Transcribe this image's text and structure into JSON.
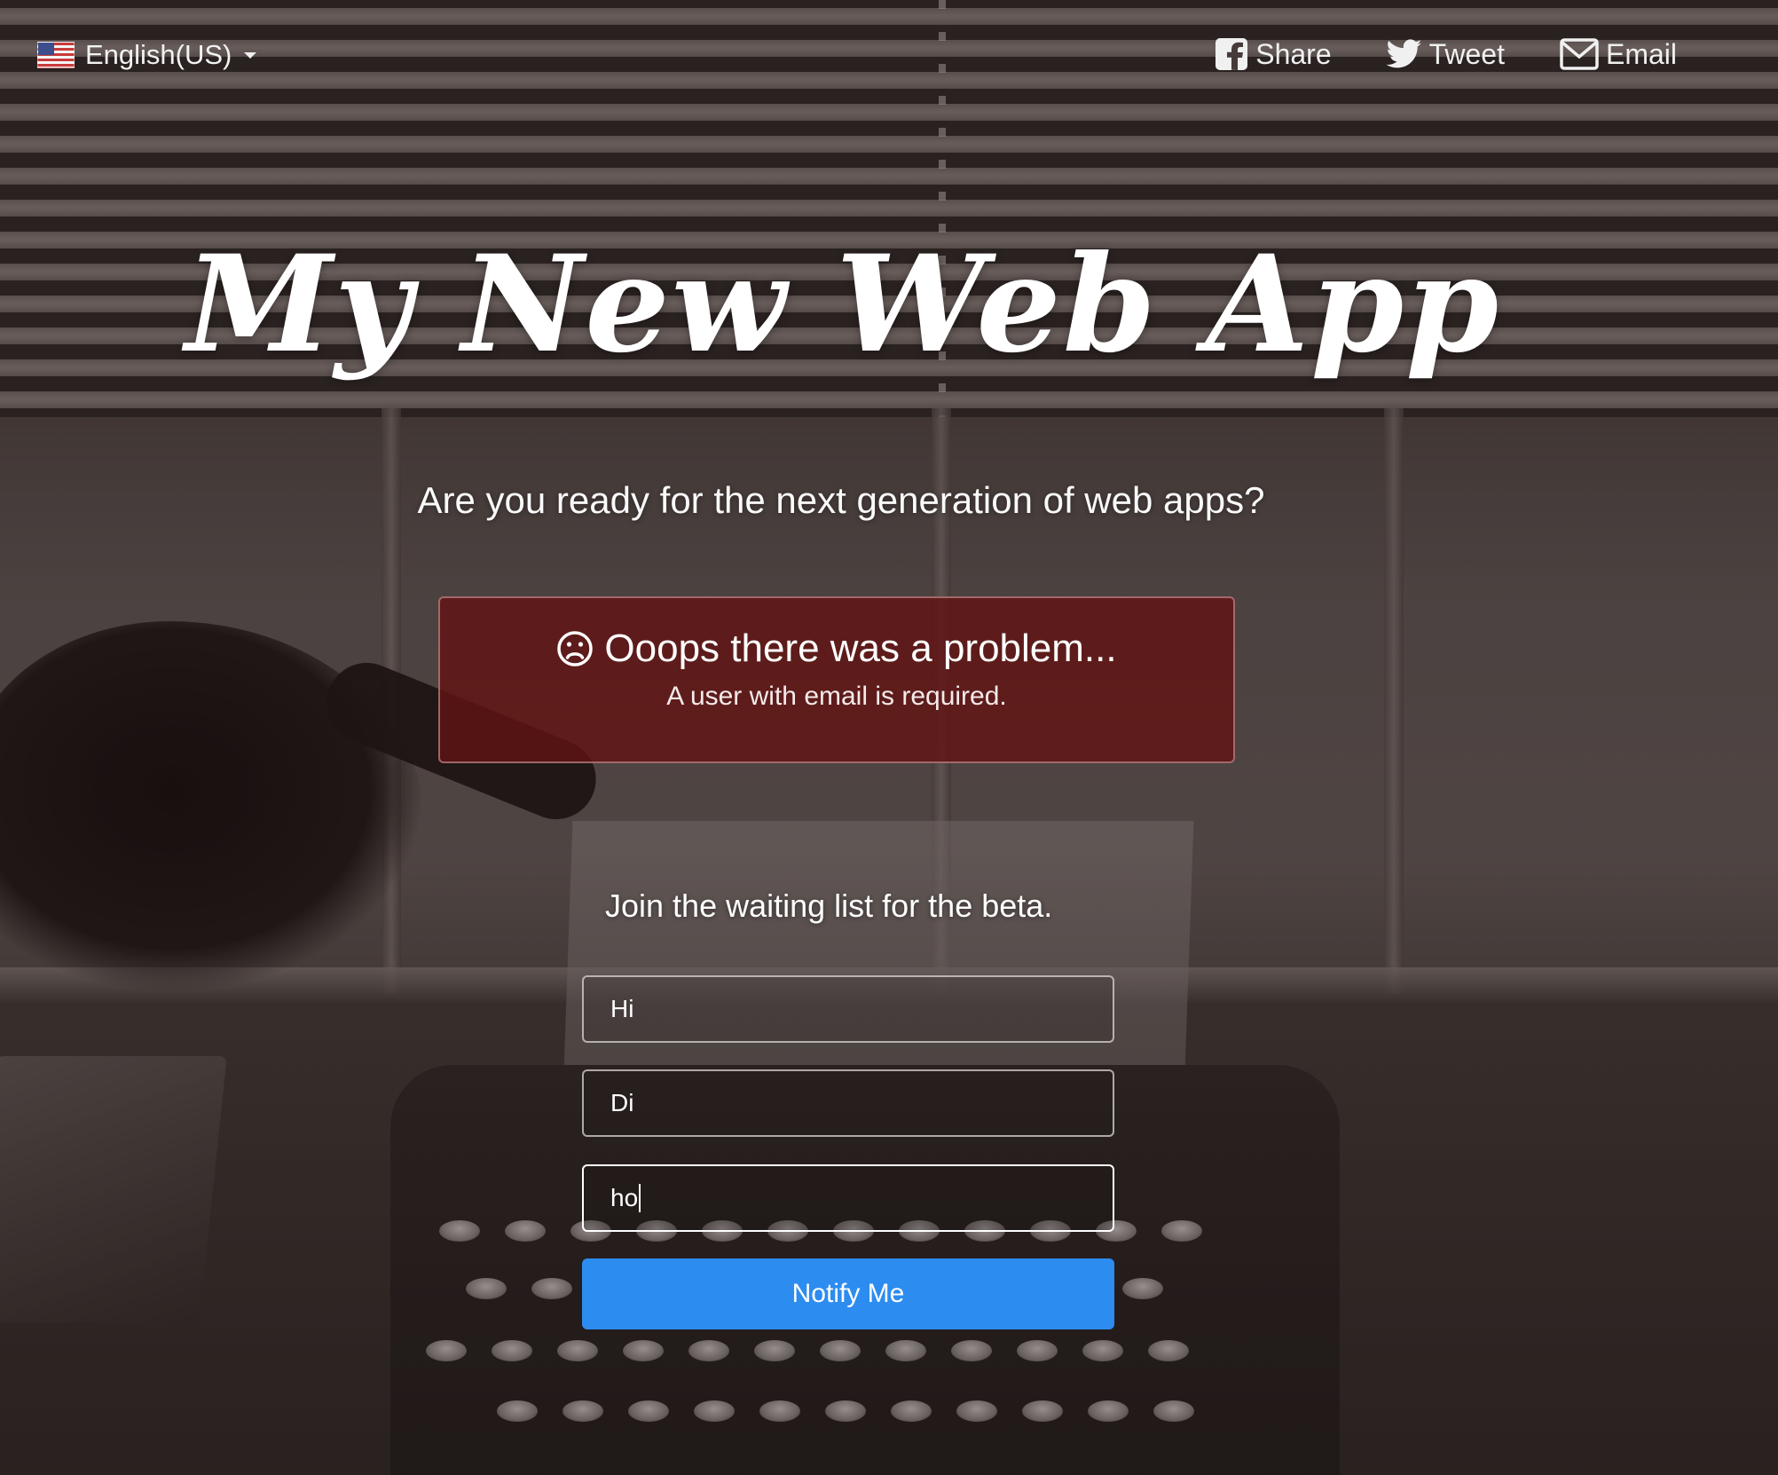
{
  "header": {
    "language": {
      "flag_icon": "us-flag-icon",
      "label": "English(US)"
    },
    "share_links": [
      {
        "icon": "facebook-icon",
        "label": "Share"
      },
      {
        "icon": "twitter-icon",
        "label": "Tweet"
      },
      {
        "icon": "envelope-icon",
        "label": "Email"
      }
    ]
  },
  "hero": {
    "title": "My New Web App",
    "subtitle": "Are you ready for the next generation of web apps?"
  },
  "alert": {
    "icon": "sad-face-icon",
    "title": "Ooops there was a problem...",
    "message": "A user with email is required.",
    "background_color": "#621414"
  },
  "signup": {
    "heading": "Join the waiting list for the beta.",
    "fields": [
      {
        "value": "Hi"
      },
      {
        "value": "Di"
      },
      {
        "value": "ho"
      }
    ],
    "submit_label": "Notify Me",
    "accent_color": "#2d8cf0"
  }
}
